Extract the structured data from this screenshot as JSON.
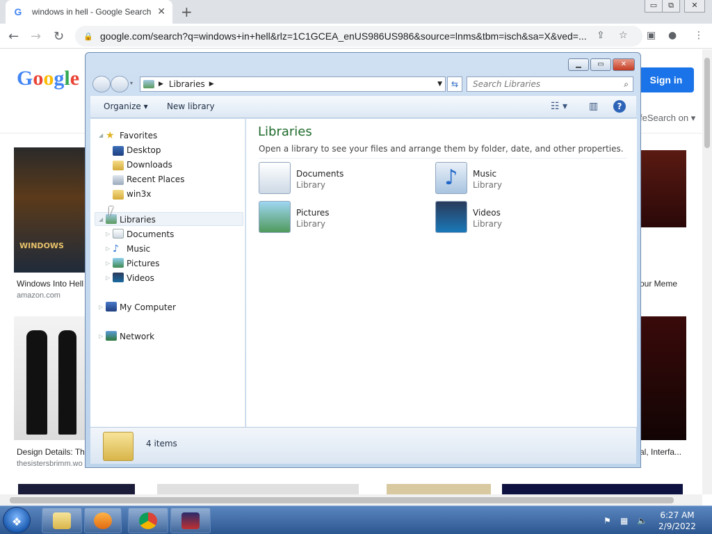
{
  "browser": {
    "tab_title": "windows in hell - Google Search",
    "tab_close": "✕",
    "new_tab": "+",
    "url": "google.com/search?q=windows+in+hell&rlz=1C1GCEA_enUS986US986&source=lnms&tbm=isch&sa=X&ved=...",
    "window_controls": {
      "minimize": "▭",
      "restore": "⧉",
      "close": "✕"
    }
  },
  "google": {
    "sign_in": "Sign in",
    "safesearch": "feSearch on ▾",
    "results": [
      {
        "caption": "Windows Into Hell",
        "source": "amazon.com"
      },
      {
        "caption": "our Meme",
        "source": ""
      },
      {
        "caption": "Design Details: Th",
        "source": "thesistersbrimm.wo"
      },
      {
        "caption": "al, Interfa...",
        "source": ""
      }
    ],
    "thumb_badge": "WINDOWS"
  },
  "explorer": {
    "address": {
      "crumb": "Libraries"
    },
    "search_placeholder": "Search Libraries",
    "commands": {
      "organize": "Organize ▾",
      "new_library": "New library"
    },
    "help": "?",
    "nav": {
      "favorites": "Favorites",
      "favorites_items": [
        "Desktop",
        "Downloads",
        "Recent Places",
        "win3x"
      ],
      "libraries": "Libraries",
      "libraries_items": [
        "Documents",
        "Music",
        "Pictures",
        "Videos"
      ],
      "computer": "My Computer",
      "network": "Network"
    },
    "content": {
      "heading": "Libraries",
      "subtitle": "Open a library to see your files and arrange them by folder, date, and other properties.",
      "items": [
        {
          "name": "Documents",
          "type": "Library"
        },
        {
          "name": "Music",
          "type": "Library"
        },
        {
          "name": "Pictures",
          "type": "Library"
        },
        {
          "name": "Videos",
          "type": "Library"
        }
      ]
    },
    "status": "4 items"
  },
  "taskbar": {
    "time": "6:27 AM",
    "date": "2/9/2022"
  }
}
